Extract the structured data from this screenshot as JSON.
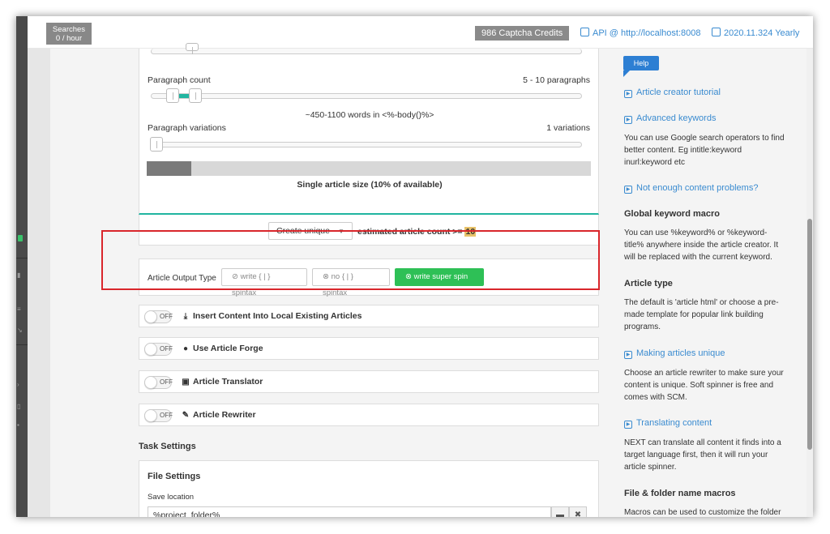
{
  "topbar": {
    "searches_label": "Searches",
    "searches_value": "0 / hour",
    "credits": "986 Captcha Credits",
    "api_link": "API @ http://localhost:8008",
    "version_link": "2020.11.324 Yearly"
  },
  "paragraphs": {
    "count_label": "Paragraph count",
    "count_value": "5 - 10 paragraphs",
    "words_info": "~450-1100 words in <%-body()%>",
    "variations_label": "Paragraph variations",
    "variations_value": "1 variations",
    "size_label": "Single article size (10% of available)",
    "size_fraction": 0.1
  },
  "create": {
    "select_value": "Create unique",
    "estimate_label": "estimated article count >=",
    "estimate_value": "10"
  },
  "output": {
    "label": "Article Output Type",
    "options": [
      {
        "label": "write { | } spintax",
        "active": false
      },
      {
        "label": "no { | } spintax",
        "active": false
      },
      {
        "label": "write super spin",
        "active": true
      }
    ]
  },
  "toggles": [
    {
      "state": "OFF",
      "title": "Insert Content Into Local Existing Articles",
      "icon": "download-icon"
    },
    {
      "state": "OFF",
      "title": "Use Article Forge",
      "icon": "forge-icon"
    },
    {
      "state": "OFF",
      "title": "Article Translator",
      "icon": "translate-icon"
    },
    {
      "state": "OFF",
      "title": "Article Rewriter",
      "icon": "pencil-icon"
    }
  ],
  "task": {
    "heading": "Task Settings",
    "file_heading": "File Settings",
    "save_label": "Save location",
    "save_value": "%project_folder%"
  },
  "help": {
    "tag": "Help",
    "tutorial": "Article creator tutorial",
    "advanced": "Advanced keywords",
    "advanced_text": "You can use Google search operators to find better content. Eg intitle:keyword inurl:keyword etc",
    "not_enough": "Not enough content problems?",
    "global_head": "Global keyword macro",
    "global_text": "You can use %keyword% or %keyword-title% anywhere inside the article creator. It will be replaced with the current keyword.",
    "type_head": "Article type",
    "type_text": "The default is 'article html' or choose a pre-made template for popular link building programs.",
    "unique_link": "Making articles unique",
    "unique_text": "Choose an article rewriter to make sure your content is unique. Soft spinner is free and comes with SCM.",
    "translating_link": "Translating content",
    "translating_text": "NEXT can translate all content it finds into a target language first, then it will run your article spinner.",
    "macros_head": "File & folder name macros",
    "macros_text": "Macros can be used to customize the folder"
  },
  "colors": {
    "accent": "#21b5a0",
    "active_green": "#2ec056",
    "link_blue": "#3a8bd0",
    "highlight_red": "#d9262b",
    "estimate_highlight": "#e8c26a"
  }
}
